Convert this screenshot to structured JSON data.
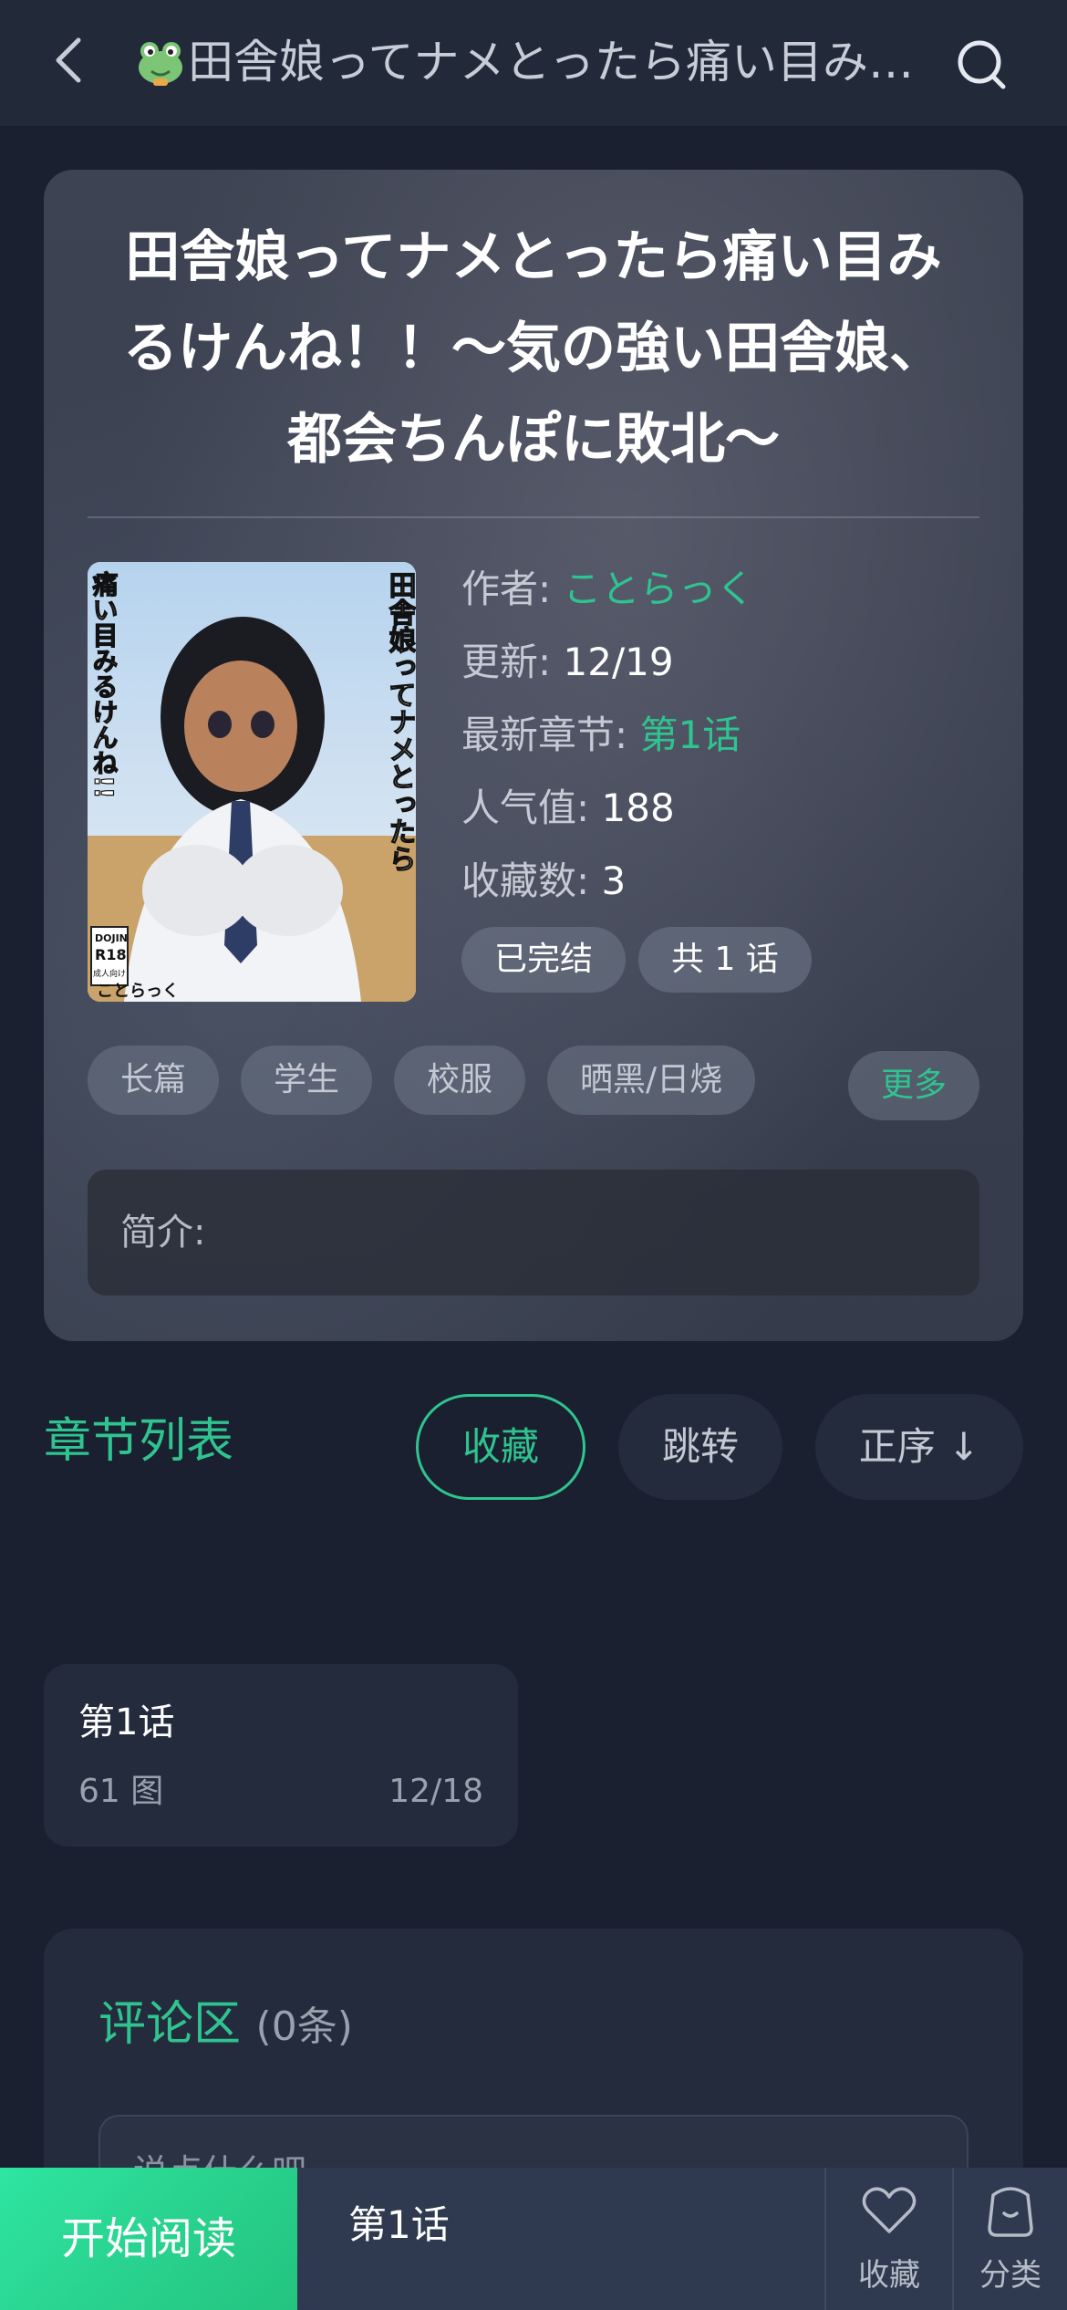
{
  "header": {
    "title": "田舎娘ってナメとったら痛い目みるけんね！！〜気の強い田舎娘、都会ちんぽに敗北〜",
    "icons": {
      "back": "back-arrow-icon",
      "frog": "frog-icon",
      "search": "search-icon"
    }
  },
  "book": {
    "title": "田舎娘ってナメとったら痛い目みるけんね！！〜気の強い田舎娘、都会ちんぽに敗北〜",
    "cover": {
      "vertical_title": "田舎娘ってナメとったら",
      "subtitle_vertical": "痛い目みるけんね!!",
      "author_mark": "ことらっく",
      "badge_top": "DOJIN",
      "badge_r18": "R18",
      "badge_bottom": "成人向け"
    },
    "meta": {
      "author_label": "作者:",
      "author": "ことらっく",
      "update_label": "更新:",
      "update": "12/19",
      "latest_label": "最新章节:",
      "latest": "第1话",
      "popularity_label": "人气值:",
      "popularity": "188",
      "favorites_label": "收藏数:",
      "favorites": "3"
    },
    "status": [
      "已完结",
      "共 1 话"
    ],
    "tags": [
      "长篇",
      "学生",
      "校服",
      "晒黑/日烧"
    ],
    "more_label": "更多",
    "intro_label": "简介:"
  },
  "chapters": {
    "heading": "章节列表",
    "favorite_btn": "收藏",
    "jump_btn": "跳转",
    "order_btn": "正序 ↓",
    "items": [
      {
        "name": "第1话",
        "count": "61 图",
        "date": "12/18"
      }
    ]
  },
  "comments": {
    "title": "评论区",
    "count": "(0条)",
    "placeholder": "说点什么吧..."
  },
  "bottombar": {
    "start_read": "开始阅读",
    "current_chapter": "第1话",
    "fav_label": "收藏",
    "category_label": "分类"
  },
  "colors": {
    "accent": "#2fc48f",
    "background": "#1a2030",
    "card": "#232b3c"
  }
}
